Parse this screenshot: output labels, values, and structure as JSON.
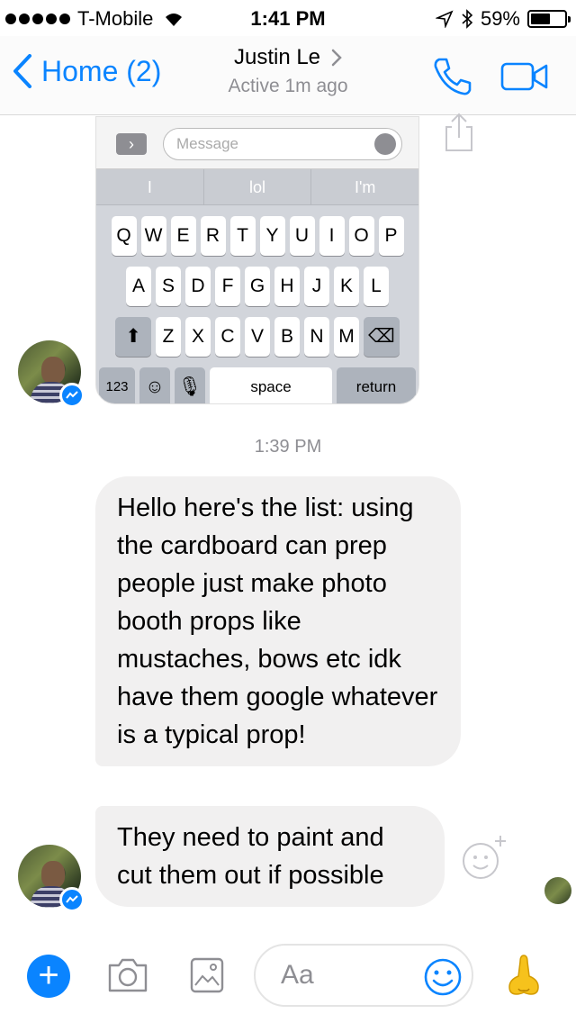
{
  "status_bar": {
    "carrier": "T-Mobile",
    "time": "1:41 PM",
    "battery_percent": "59%",
    "battery_level": 0.59,
    "icons": [
      "signal-dots-icon",
      "wifi-icon",
      "location-arrow-icon",
      "bluetooth-icon",
      "battery-icon"
    ]
  },
  "nav": {
    "back_label": "Home (2)",
    "contact_name": "Justin Le",
    "contact_status": "Active 1m ago",
    "accent_color": "#0a84ff",
    "icons": [
      "back-chevron-icon",
      "chevron-right-icon",
      "phone-icon",
      "video-camera-icon"
    ]
  },
  "shared_screenshot": {
    "input_placeholder": "Message",
    "suggestions": [
      "I",
      "lol",
      "I'm"
    ],
    "rows": [
      [
        "Q",
        "W",
        "E",
        "R",
        "T",
        "Y",
        "U",
        "I",
        "O",
        "P"
      ],
      [
        "A",
        "S",
        "D",
        "F",
        "G",
        "H",
        "J",
        "K",
        "L"
      ],
      [
        "Z",
        "X",
        "C",
        "V",
        "B",
        "N",
        "M"
      ]
    ],
    "bottom_keys": {
      "numbers": "123",
      "space": "space",
      "return": "return"
    }
  },
  "chat": {
    "timestamp": "1:39 PM",
    "messages": [
      {
        "text": "Hello here's the list: using the cardboard can prep people just make photo booth props like mustaches, bows etc idk have them google whatever is a typical prop!"
      },
      {
        "text": "They need to paint and cut them out if possible"
      }
    ]
  },
  "composer": {
    "placeholder": "Aa",
    "icons": [
      "plus-icon",
      "camera-icon",
      "image-icon",
      "smiley-icon",
      "thumbs-emoji-icon"
    ]
  }
}
